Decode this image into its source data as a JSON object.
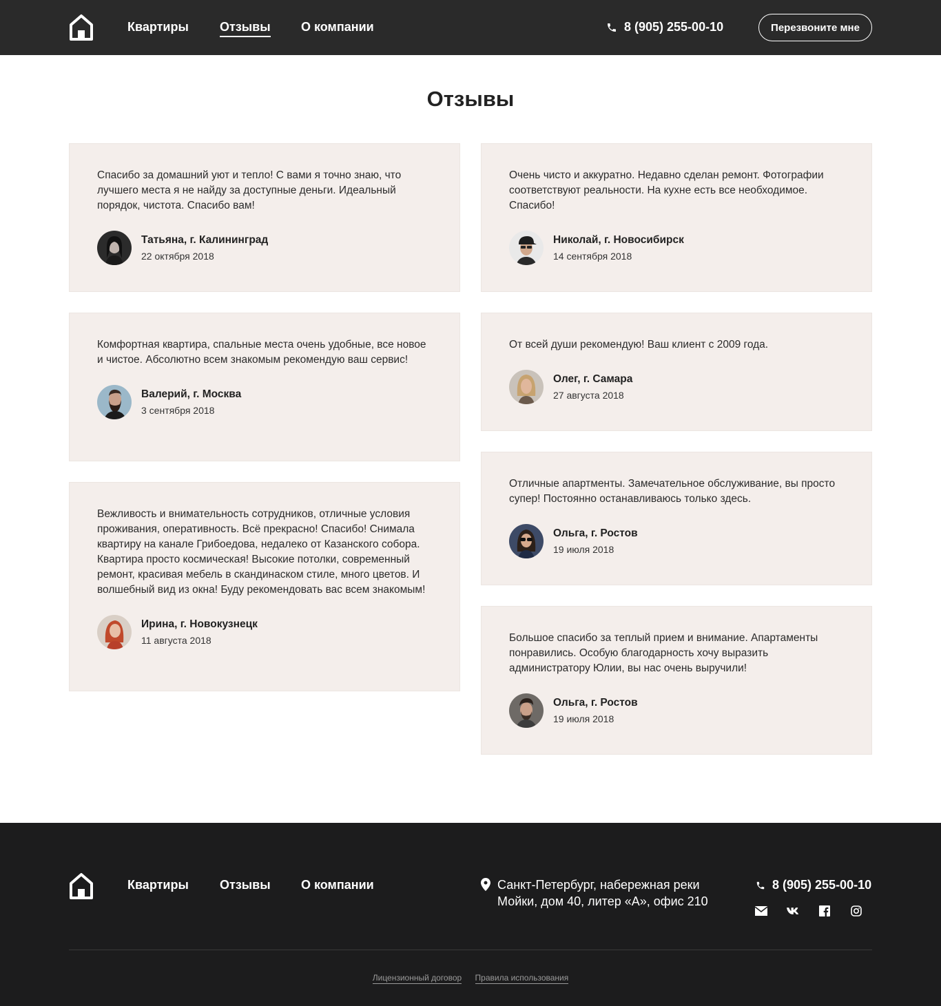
{
  "header": {
    "nav": [
      {
        "label": "Квартиры"
      },
      {
        "label": "Отзывы"
      },
      {
        "label": "О компании"
      }
    ],
    "phone": "8 (905) 255-00-10",
    "callback_label": "Перезвоните мне"
  },
  "page_title": "Отзывы",
  "reviews_left": [
    {
      "text": "Спасибо за домашний уют и тепло! С вами я точно знаю, что лучшего места я не найду за доступные деньги. Идеальный порядок, чистота. Спасибо вам!",
      "name": "Татьяна, г. Калининград",
      "date": "22 октября 2018"
    },
    {
      "text": "Комфортная квартира, спальные места очень удобные, все новое и чистое. Абсолютно всем знакомым рекомендую ваш сервис!",
      "name": "Валерий, г. Москва",
      "date": "3 сентября 2018"
    },
    {
      "text": "Вежливость и внимательность сотрудников, отличные условия проживания, оперативность. Всё прекрасно! Спасибо! Снимала квартиру на канале Грибоедова, недалеко от Казанского собора. Квартира просто космическая! Высокие потолки, современный ремонт, красивая мебель в скандинаском стиле, много цветов. И волшебный вид из окна! Буду рекомендовать вас всем знакомым!",
      "name": "Ирина, г. Новокузнецк",
      "date": "11 августа 2018"
    }
  ],
  "reviews_right": [
    {
      "text": "Очень чисто и аккуратно. Недавно сделан ремонт. Фотографии соответствуют реальности. На кухне есть все необходимое. Спасибо!",
      "name": "Николай, г. Новосибирск",
      "date": "14 сентября 2018"
    },
    {
      "text": "От всей души рекомендую! Ваш клиент с 2009 года.",
      "name": "Олег, г. Самара",
      "date": "27 августа 2018"
    },
    {
      "text": "Отличные апартменты. Замечательное обслуживание, вы просто супер! Постоянно останавливаюсь только здесь.",
      "name": "Ольга, г. Ростов",
      "date": "19 июля 2018"
    },
    {
      "text": "Большое спасибо за теплый прием и внимание. Апартаменты понравились. Особую благодарность хочу выразить администратору Юлии, вы нас очень выручили!",
      "name": "Ольга, г. Ростов",
      "date": "19 июля 2018"
    }
  ],
  "footer": {
    "nav": [
      {
        "label": "Квартиры"
      },
      {
        "label": "Отзывы"
      },
      {
        "label": "О компании"
      }
    ],
    "address": "Санкт-Петербург, набережная реки Мойки, дом 40, литер «А», офис 210",
    "phone": "8 (905) 255-00-10",
    "socials": [
      "mail-icon",
      "vk-icon",
      "facebook-icon",
      "instagram-icon"
    ],
    "legal": [
      {
        "label": "Лицензионный договор"
      },
      {
        "label": "Правила использования"
      }
    ]
  },
  "colors": {
    "header_bg": "#2a2a2a",
    "footer_bg": "#1c1c1d",
    "card_bg": "#f4eeeb",
    "text": "#2b2b2b"
  }
}
